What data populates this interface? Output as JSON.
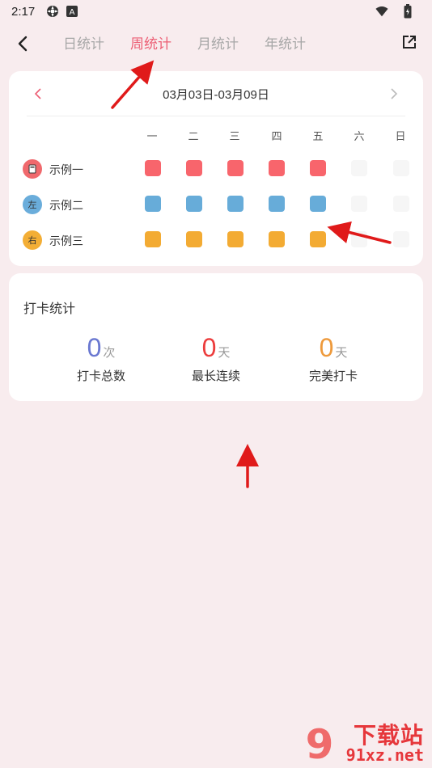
{
  "status_bar": {
    "time": "2:17",
    "icons": [
      "settings-icon",
      "a-icon",
      "wifi-icon",
      "battery-icon"
    ]
  },
  "header": {
    "tabs": [
      {
        "label": "日统计",
        "active": false
      },
      {
        "label": "周统计",
        "active": true
      },
      {
        "label": "月统计",
        "active": false
      },
      {
        "label": "年统计",
        "active": false
      }
    ],
    "back_icon": "chevron-left-icon",
    "share_icon": "share-external-icon"
  },
  "week": {
    "range": "03月03日-03月09日",
    "weekdays": [
      "一",
      "二",
      "三",
      "四",
      "五",
      "六",
      "日"
    ],
    "habits": [
      {
        "name": "示例一",
        "icon_text": "",
        "icon_color": "#f0696d",
        "cell_color": "#f8656c",
        "checked": [
          true,
          true,
          true,
          true,
          true,
          false,
          false
        ]
      },
      {
        "name": "示例二",
        "icon_text": "左",
        "icon_color": "#6aaddb",
        "cell_color": "#67acd9",
        "checked": [
          true,
          true,
          true,
          true,
          true,
          false,
          false
        ]
      },
      {
        "name": "示例三",
        "icon_text": "右",
        "icon_color": "#f3ae36",
        "cell_color": "#f3ab33",
        "checked": [
          true,
          true,
          true,
          true,
          true,
          false,
          false
        ]
      }
    ]
  },
  "stats": {
    "title": "打卡统计",
    "items": [
      {
        "value": "0",
        "unit": "次",
        "label": "打卡总数",
        "color": "#6a78d1"
      },
      {
        "value": "0",
        "unit": "天",
        "label": "最长连续",
        "color": "#ec3d3d"
      },
      {
        "value": "0",
        "unit": "天",
        "label": "完美打卡",
        "color": "#ee9a3c"
      }
    ]
  },
  "watermark": {
    "line1": "下载站",
    "line2": "91xz.net",
    "logo_text": "9"
  },
  "colors": {
    "accent": "#ec5e74",
    "background": "#f8ecee",
    "arrow": "#e01a1a"
  }
}
